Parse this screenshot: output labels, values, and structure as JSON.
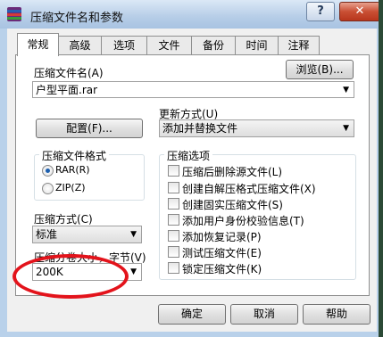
{
  "window": {
    "title": "压缩文件名和参数",
    "help_glyph": "?",
    "close_glyph": "✕"
  },
  "tabs": [
    {
      "label": "常规",
      "active": true
    },
    {
      "label": "高级"
    },
    {
      "label": "选项"
    },
    {
      "label": "文件"
    },
    {
      "label": "备份"
    },
    {
      "label": "时间"
    },
    {
      "label": "注释"
    }
  ],
  "general": {
    "archive_name_label": "压缩文件名(A)",
    "archive_name_value": "户型平面.rar",
    "browse_button": "浏览(B)...",
    "profiles_button": "配置(F)...",
    "update_mode_label": "更新方式(U)",
    "update_mode_value": "添加并替换文件",
    "format_group_label": "压缩文件格式",
    "format_options": [
      {
        "label": "RAR(R)",
        "selected": true
      },
      {
        "label": "ZIP(Z)",
        "selected": false
      }
    ],
    "method_label": "压缩方式(C)",
    "method_value": "标准",
    "split_label": "压缩分卷大小，字节(V)",
    "split_value": "200K",
    "options_group_label": "压缩选项",
    "options": [
      "压缩后删除源文件(L)",
      "创建自解压格式压缩文件(X)",
      "创建固实压缩文件(S)",
      "添加用户身份校验信息(T)",
      "添加恢复记录(P)",
      "测试压缩文件(E)",
      "锁定压缩文件(K)"
    ]
  },
  "footer": {
    "ok_button": "确定",
    "cancel_button": "取消",
    "help_button": "帮助"
  },
  "colors": {
    "annotation": "#e3131b",
    "radio_dot": "#1d5fae"
  }
}
